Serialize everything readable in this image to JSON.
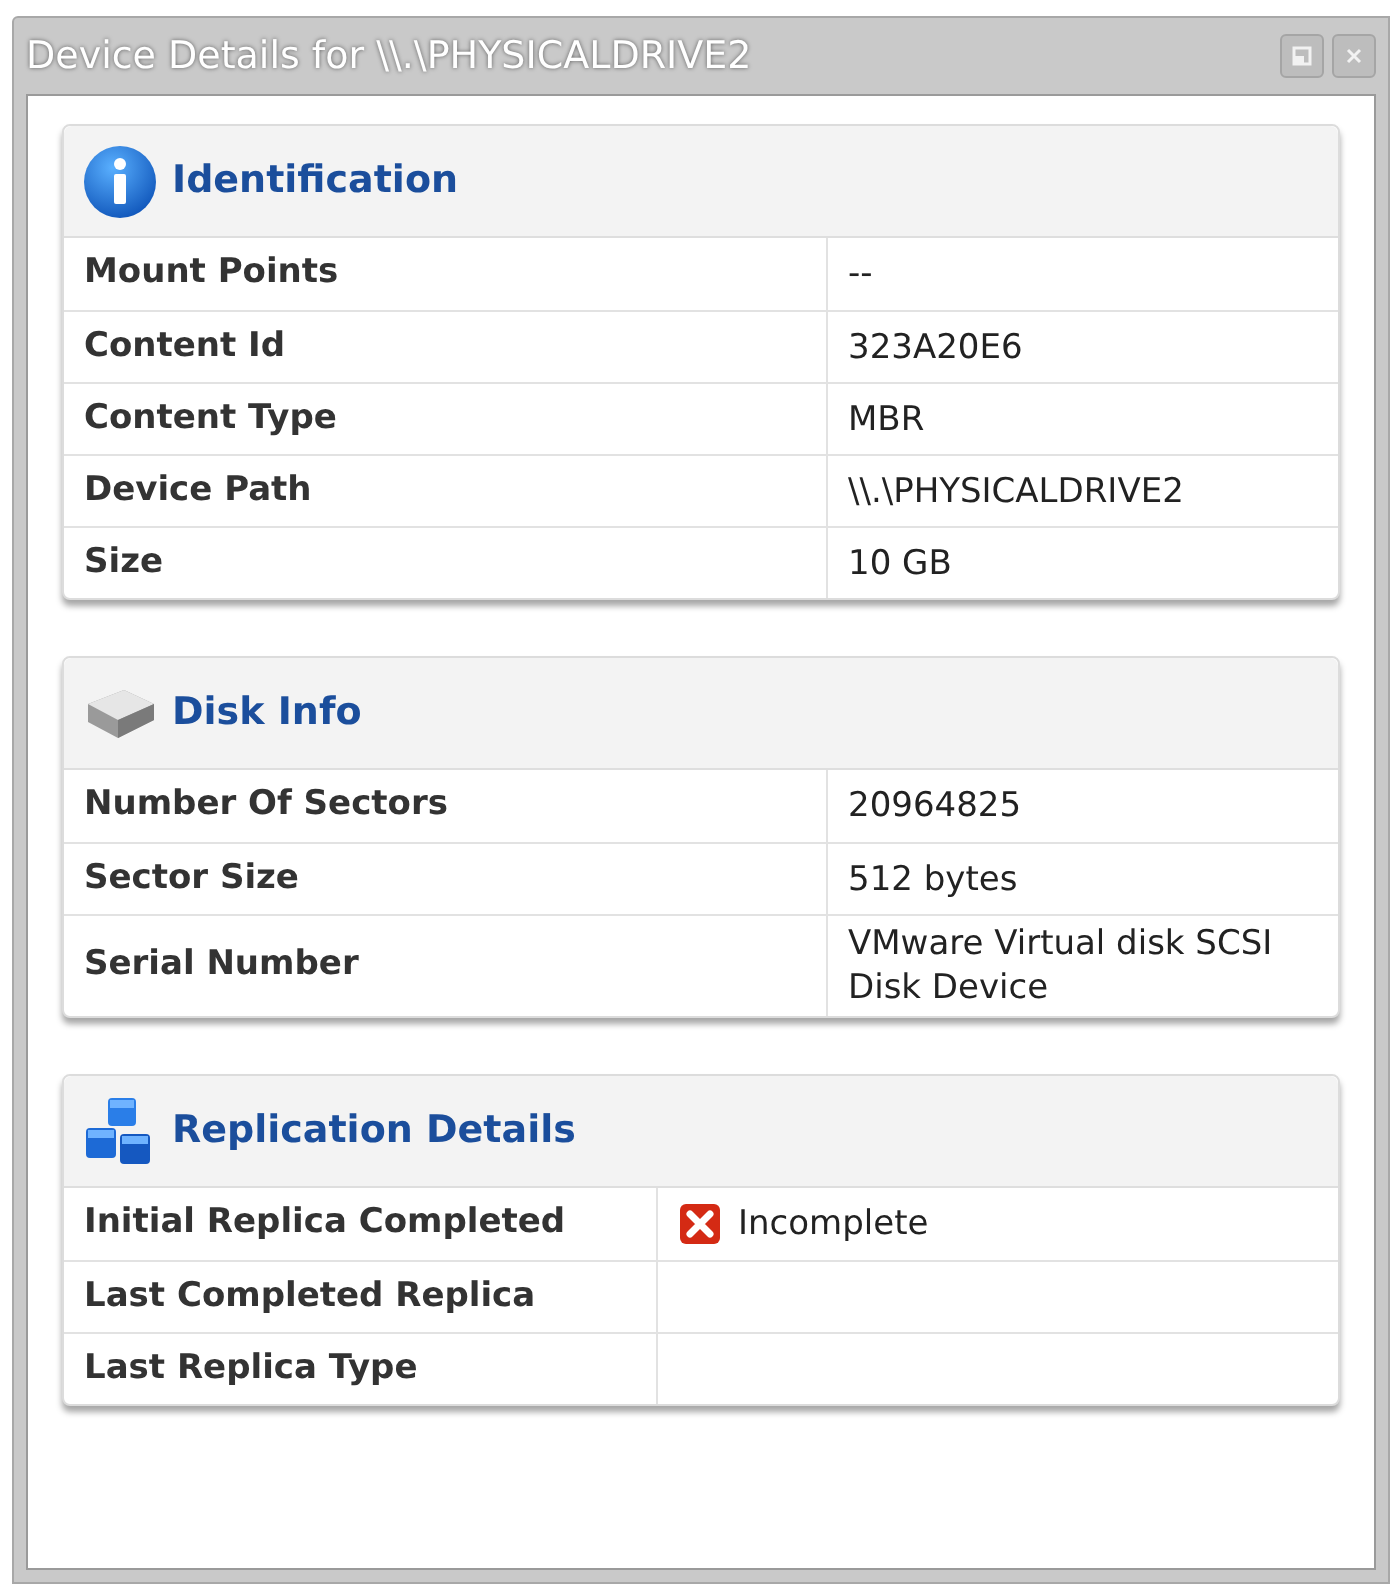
{
  "window": {
    "title": "Device Details for \\\\.\\PHYSICALDRIVE2"
  },
  "sections": [
    {
      "title": "Identification",
      "rows": [
        {
          "label": "Mount Points",
          "value": "--"
        },
        {
          "label": "Content Id",
          "value": "323A20E6"
        },
        {
          "label": "Content Type",
          "value": "MBR"
        },
        {
          "label": "Device Path",
          "value": "\\\\.\\PHYSICALDRIVE2"
        },
        {
          "label": "Size",
          "value": "10 GB"
        }
      ]
    },
    {
      "title": "Disk Info",
      "rows": [
        {
          "label": "Number Of Sectors",
          "value": "20964825"
        },
        {
          "label": "Sector Size",
          "value": "512 bytes"
        },
        {
          "label": "Serial Number",
          "value": "VMware Virtual disk SCSI Disk Device"
        }
      ]
    },
    {
      "title": "Replication Details",
      "rows": [
        {
          "label": "Initial Replica Completed",
          "value": "Incomplete",
          "kind": "failed"
        },
        {
          "label": "Last Completed Replica"
        },
        {
          "label": "Last Replica Type"
        }
      ]
    }
  ]
}
